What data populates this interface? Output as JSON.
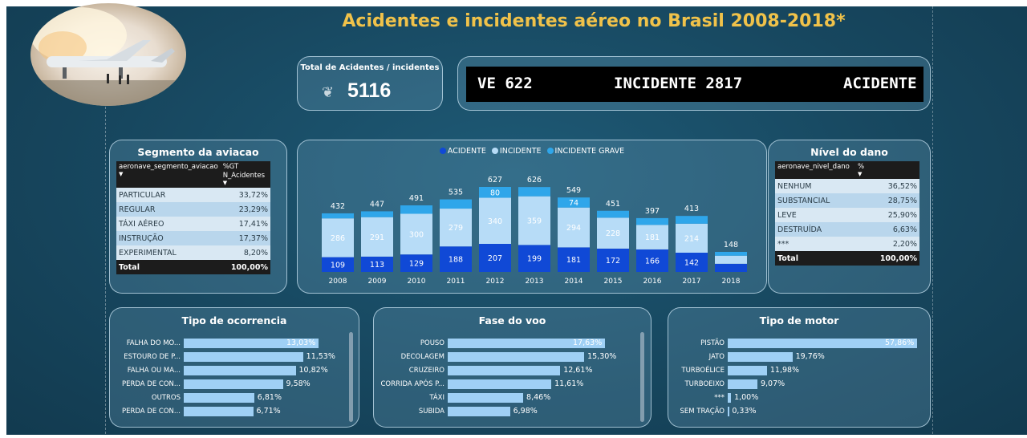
{
  "header": {
    "title": "Acidentes e incidentes aéreo no Brasil 2008-2018*"
  },
  "kpi": {
    "label": "Total de Acidentes / incidentes",
    "value": "5116",
    "icon": "wings-emblem-icon"
  },
  "ticker": {
    "items": [
      "VE 622",
      "INCIDENTE 2817",
      "ACIDENTE"
    ]
  },
  "segmento": {
    "title": "Segmento da aviacao",
    "columns": [
      "aeronave_segmento_aviacao",
      "%GT N_Acidentes"
    ],
    "rows": [
      {
        "label": "PARTICULAR",
        "value": "33,72%"
      },
      {
        "label": "REGULAR",
        "value": "23,29%"
      },
      {
        "label": "TÁXI AÉREO",
        "value": "17,41%"
      },
      {
        "label": "INSTRUÇÃO",
        "value": "17,37%"
      },
      {
        "label": "EXPERIMENTAL",
        "value": "8,20%"
      }
    ],
    "total_label": "Total",
    "total_value": "100,00%"
  },
  "nivel": {
    "title": "Nível do dano",
    "columns": [
      "aeronave_nivel_dano",
      "%"
    ],
    "rows": [
      {
        "label": "NENHUM",
        "value": "36,52%"
      },
      {
        "label": "SUBSTANCIAL",
        "value": "28,75%"
      },
      {
        "label": "LEVE",
        "value": "25,90%"
      },
      {
        "label": "DESTRUÍDA",
        "value": "6,63%"
      },
      {
        "label": "***",
        "value": "2,20%"
      }
    ],
    "total_label": "Total",
    "total_value": "100,00%"
  },
  "colors": {
    "acidente": "#1049d6",
    "incidente": "#b7dcf7",
    "incidente_grave": "#2fa6ea",
    "hbar": "#9fd0f5",
    "title": "#f0c24a"
  },
  "chart_data": [
    {
      "type": "bar",
      "stacked": true,
      "categories": [
        "2008",
        "2009",
        "2010",
        "2011",
        "2012",
        "2013",
        "2014",
        "2015",
        "2016",
        "2017",
        "2018"
      ],
      "series": [
        {
          "name": "ACIDENTE",
          "values": [
            109,
            113,
            129,
            188,
            207,
            199,
            181,
            172,
            166,
            142,
            60
          ]
        },
        {
          "name": "INCIDENTE",
          "values": [
            286,
            291,
            300,
            279,
            340,
            359,
            294,
            228,
            181,
            214,
            60
          ]
        },
        {
          "name": "INCIDENTE GRAVE",
          "values": [
            37,
            43,
            62,
            68,
            80,
            68,
            74,
            51,
            50,
            57,
            28
          ]
        }
      ],
      "totals": [
        432,
        447,
        491,
        535,
        627,
        626,
        549,
        451,
        397,
        413,
        148
      ],
      "label_ACIDENTE": [
        "109",
        "113",
        "129",
        "188",
        "207",
        "199",
        "181",
        "172",
        "166",
        "142",
        ""
      ],
      "label_INCIDENTE": [
        "286",
        "291",
        "300",
        "279",
        "340",
        "359",
        "294",
        "228",
        "181",
        "214",
        ""
      ],
      "label_INCIDENTE GRAVE": [
        "",
        "",
        "",
        "",
        "80",
        "",
        "74",
        "",
        "",
        "",
        ""
      ],
      "legend": "top",
      "ylim": [
        0,
        627
      ]
    },
    {
      "type": "bar",
      "orientation": "horizontal",
      "title": "Tipo de ocorrencia",
      "categories": [
        "FALHA DO MO...",
        "ESTOURO DE P...",
        "FALHA OU MA...",
        "PERDA DE CON...",
        "OUTROS",
        "PERDA DE CON..."
      ],
      "values": [
        13.03,
        11.53,
        10.82,
        9.58,
        6.81,
        6.71
      ],
      "labels": [
        "13,03%",
        "11,53%",
        "10,82%",
        "9,58%",
        "6,81%",
        "6,71%"
      ]
    },
    {
      "type": "bar",
      "orientation": "horizontal",
      "title": "Fase do voo",
      "categories": [
        "POUSO",
        "DECOLAGEM",
        "CRUZEIRO",
        "CORRIDA APÓS P...",
        "TÁXI",
        "SUBIDA"
      ],
      "values": [
        17.63,
        15.3,
        12.61,
        11.61,
        8.46,
        6.98
      ],
      "labels": [
        "17,63%",
        "15,30%",
        "12,61%",
        "11,61%",
        "8,46%",
        "6,98%"
      ]
    },
    {
      "type": "bar",
      "orientation": "horizontal",
      "title": "Tipo de motor",
      "categories": [
        "PISTÃO",
        "JATO",
        "TURBOÉLICE",
        "TURBOEIXO",
        "***",
        "SEM TRAÇÃO"
      ],
      "values": [
        57.86,
        19.76,
        11.98,
        9.07,
        1.0,
        0.33
      ],
      "labels": [
        "57,86%",
        "19,76%",
        "11,98%",
        "9,07%",
        "1,00%",
        "0,33%"
      ]
    }
  ]
}
